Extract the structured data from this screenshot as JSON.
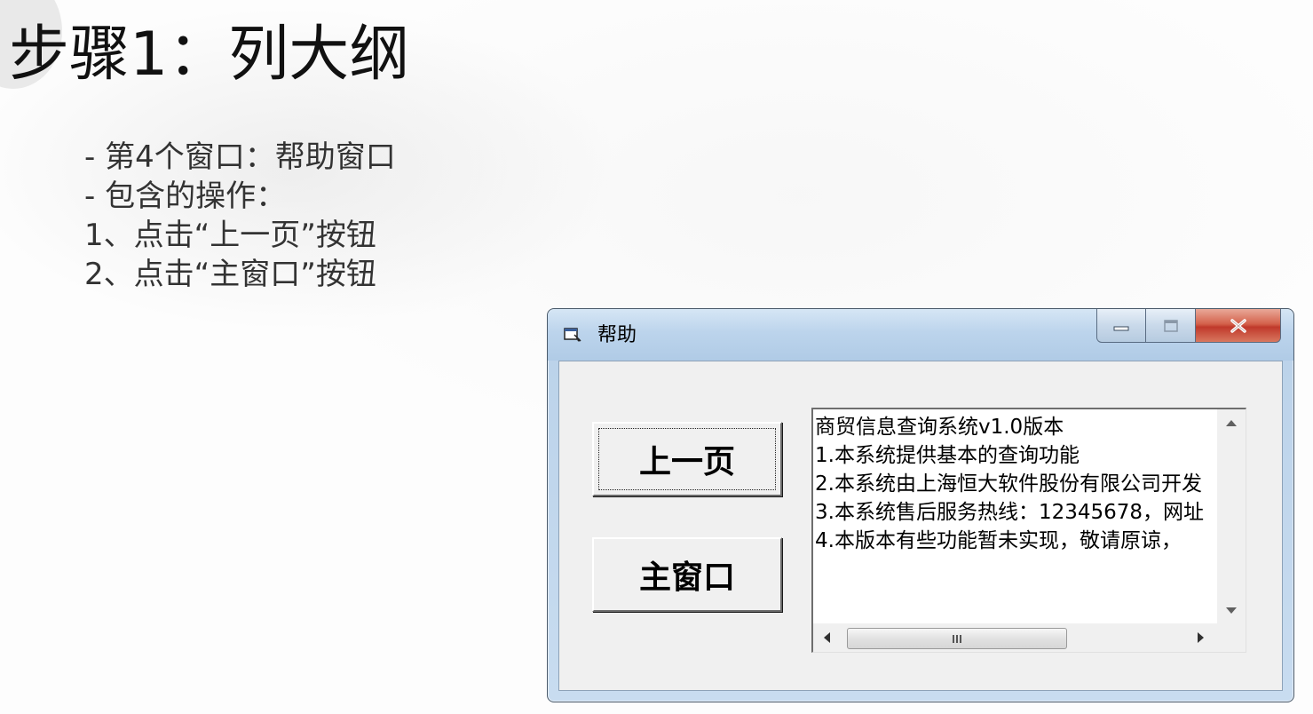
{
  "slide": {
    "title": "步骤1：列大纲",
    "bullets": [
      "- 第4个窗口：帮助窗口",
      "- 包含的操作：",
      "1、点击“上一页”按钮",
      "2、点击“主窗口”按钮"
    ]
  },
  "window": {
    "title": "帮助",
    "title_icon": "form-icon",
    "caption_buttons": {
      "minimize": "minimize-icon",
      "maximize": "maximize-icon",
      "close": "close-icon"
    },
    "buttons": {
      "prev_label": "上一页",
      "main_label": "主窗口"
    },
    "textbox": {
      "lines": [
        "商贸信息查询系统v1.0版本",
        "1.本系统提供基本的查询功能",
        "2.本系统由上海恒大软件股份有限公司开发",
        "3.本系统售后服务热线：12345678，网址",
        "4.本版本有些功能暂未实现，敬请原谅，"
      ],
      "hscroll_position": 0.1
    },
    "colors": {
      "close_button": "#c0392b",
      "titlebar": "#bcd4ec",
      "client": "#f0f0f0"
    }
  }
}
